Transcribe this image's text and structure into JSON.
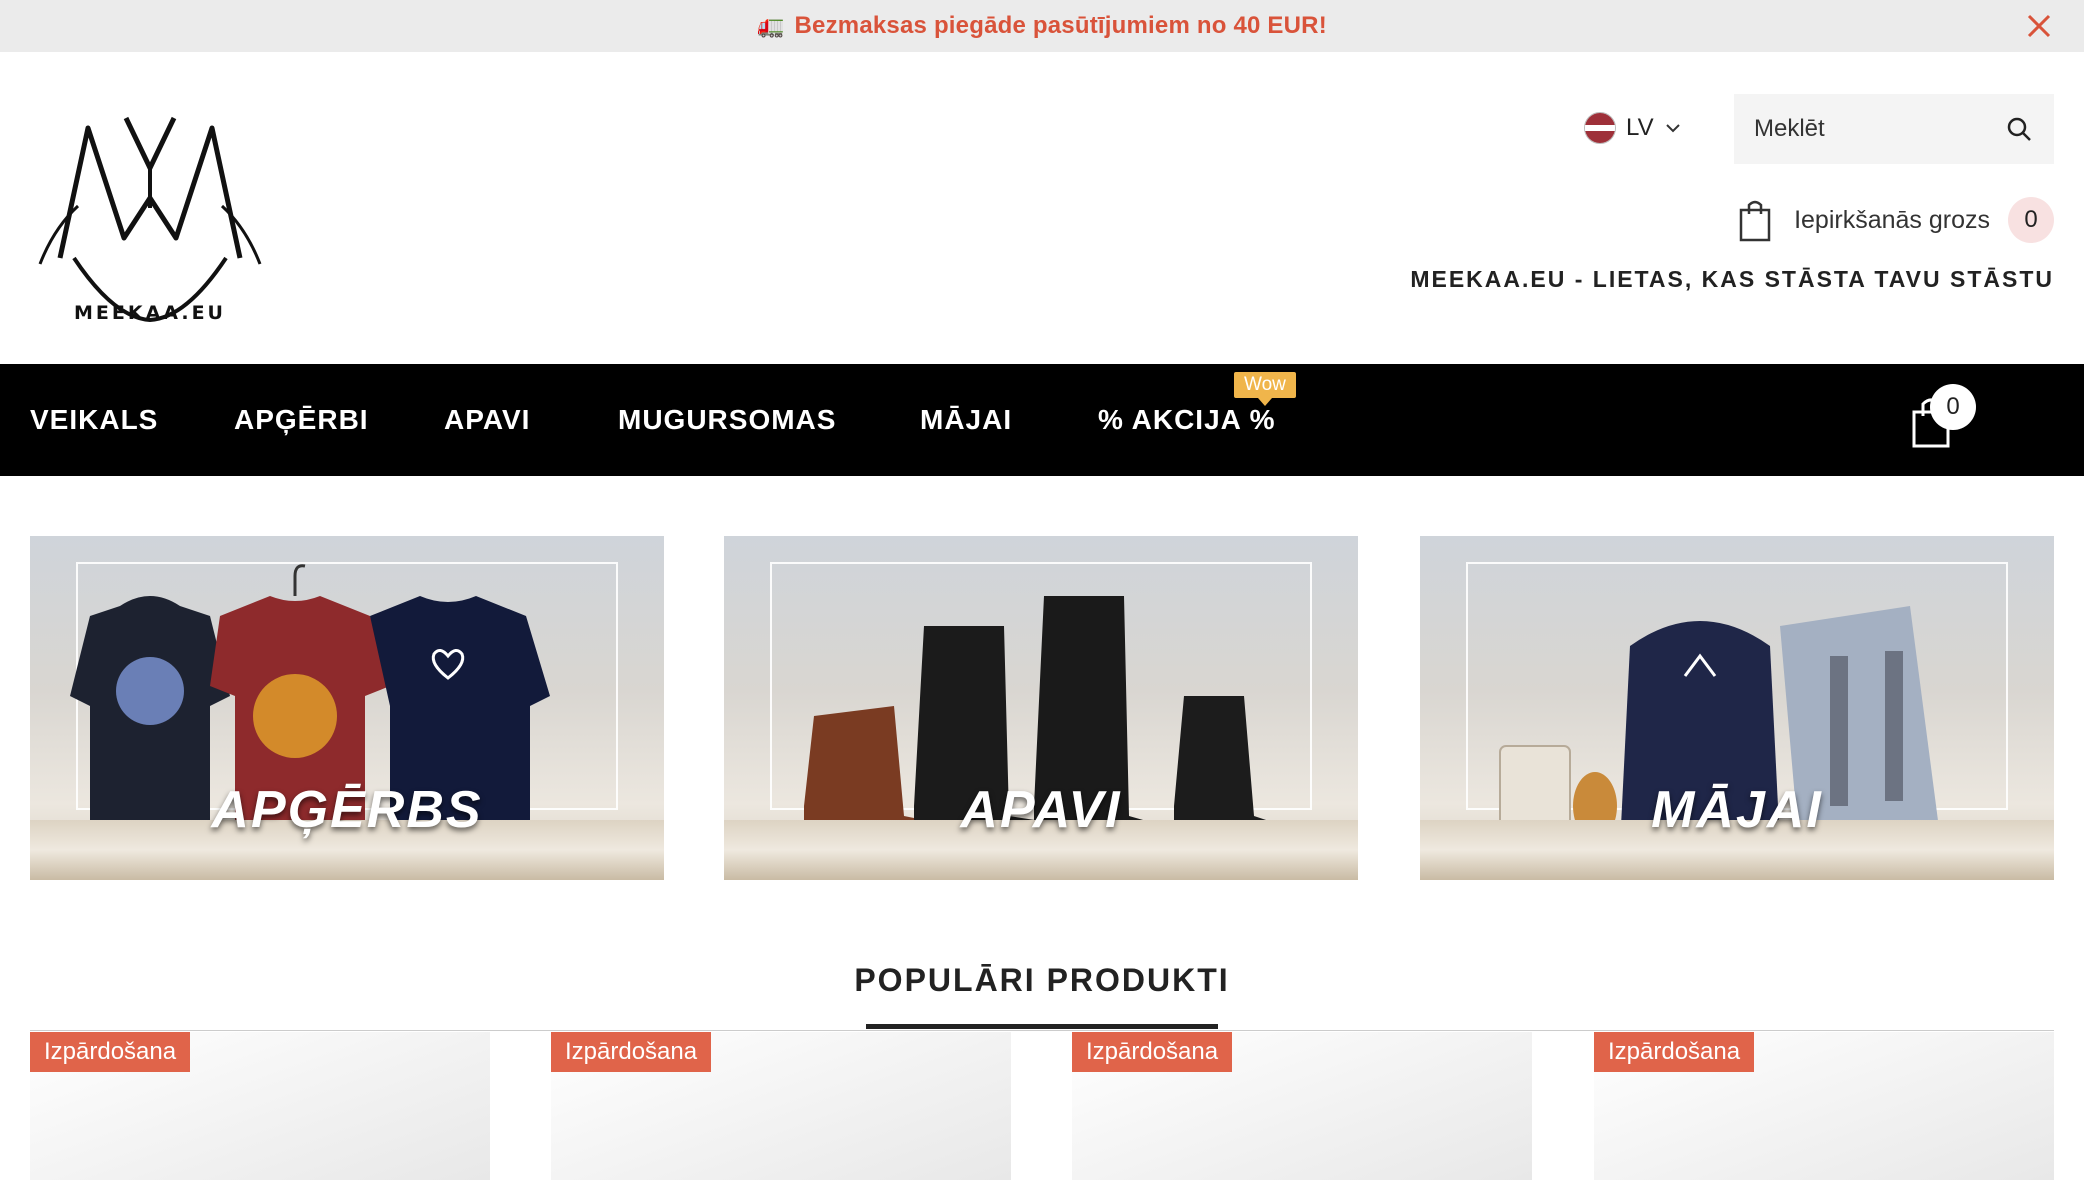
{
  "announcement": {
    "text": "Bezmaksas piegāde pasūtījumiem no 40 EUR!"
  },
  "header": {
    "logo_text": "MEEKAA.EU",
    "language": "LV",
    "search_placeholder": "Meklēt",
    "cart_label": "Iepirkšanās grozs",
    "cart_count": "0",
    "tagline": "MEEKAA.EU - LIETAS, KAS STĀSTA TAVU STĀSTU"
  },
  "nav": {
    "items": [
      "VEIKALS",
      "APĢĒRBI",
      "APAVI",
      "MUGURSOMAS",
      "MĀJAI",
      "% AKCIJA %"
    ],
    "badge": "Wow",
    "cart_count": "0"
  },
  "banners": [
    {
      "label": "APĢĒRBS"
    },
    {
      "label": "APAVI"
    },
    {
      "label": "MĀJAI"
    }
  ],
  "popular": {
    "title": "POPULĀRI PRODUKTI",
    "products": [
      {
        "badge": "Izpārdošana"
      },
      {
        "badge": "Izpārdošana"
      },
      {
        "badge": "Izpārdošana"
      },
      {
        "badge": "Izpārdošana"
      }
    ]
  },
  "colors": {
    "accent_sale": "#e0644a",
    "announce_text": "#d9533a",
    "nav_bg": "#000000",
    "badge": "#f0b54b"
  }
}
